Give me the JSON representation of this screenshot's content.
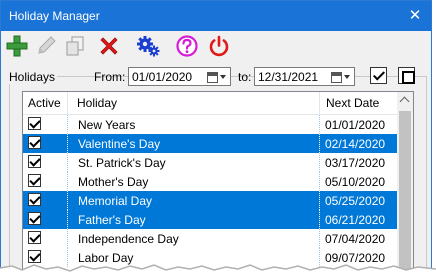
{
  "window": {
    "title": "Holiday Manager",
    "close_glyph": "✕",
    "accent_color": "#1a73d6"
  },
  "toolbar": {
    "buttons": [
      {
        "name": "add",
        "icon": "plus-icon",
        "color": "#3c9b3c"
      },
      {
        "name": "edit",
        "icon": "pencil-icon",
        "color": "#b8b8b8"
      },
      {
        "name": "copy",
        "icon": "copy-icon",
        "color": "#b8b8b8"
      },
      {
        "name": "delete",
        "icon": "delete-x-icon",
        "color": "#e01818"
      },
      {
        "name": "settings",
        "icon": "gears-icon",
        "color": "#1a3fd0"
      },
      {
        "name": "help",
        "icon": "question-icon",
        "color": "#d61cd6"
      },
      {
        "name": "exit",
        "icon": "power-icon",
        "color": "#e01818"
      }
    ]
  },
  "filter": {
    "group_label": "Holidays",
    "from_label": "From:",
    "from_value": "01/01/2020",
    "to_label": "to:",
    "to_value": "12/31/2021",
    "check_all_checked": true
  },
  "list": {
    "columns": [
      "Active",
      "Holiday",
      "Next Date"
    ],
    "selection_color": "#0078d7",
    "rows": [
      {
        "active": true,
        "holiday": "New Years",
        "next_date": "01/01/2020",
        "selected": false
      },
      {
        "active": true,
        "holiday": "Valentine's Day",
        "next_date": "02/14/2020",
        "selected": true
      },
      {
        "active": true,
        "holiday": "St. Patrick's Day",
        "next_date": "03/17/2020",
        "selected": false
      },
      {
        "active": true,
        "holiday": "Mother's Day",
        "next_date": "05/10/2020",
        "selected": false
      },
      {
        "active": true,
        "holiday": "Memorial Day",
        "next_date": "05/25/2020",
        "selected": true
      },
      {
        "active": true,
        "holiday": "Father's Day",
        "next_date": "06/21/2020",
        "selected": true
      },
      {
        "active": true,
        "holiday": "Independence Day",
        "next_date": "07/04/2020",
        "selected": false
      },
      {
        "active": true,
        "holiday": "Labor Day",
        "next_date": "09/07/2020",
        "selected": false
      }
    ]
  }
}
